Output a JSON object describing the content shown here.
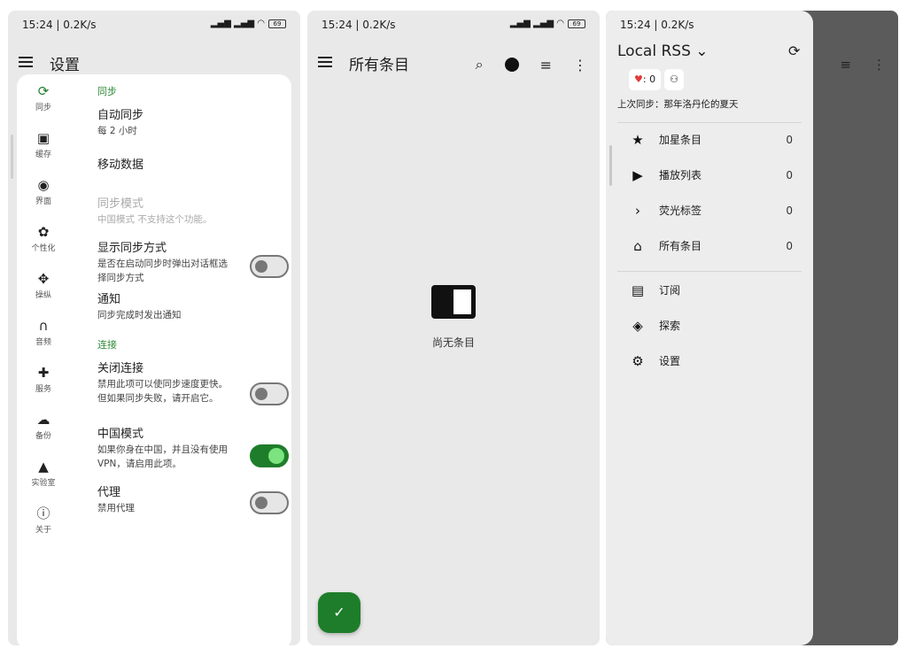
{
  "status": {
    "time": "15:24 | 0.2K/s",
    "signal": "ₗᵢₗ ₗᵢₗ",
    "battery": "69"
  },
  "settings_screen": {
    "title": "设置",
    "nav": [
      {
        "label": "同步",
        "icon": "sync-icon",
        "glyph": "⟳"
      },
      {
        "label": "缓存",
        "icon": "archive-icon",
        "glyph": "▣"
      },
      {
        "label": "界面",
        "icon": "eye-icon",
        "glyph": "◉"
      },
      {
        "label": "个性化",
        "icon": "palette-icon",
        "glyph": "✿"
      },
      {
        "label": "操纵",
        "icon": "gamepad-icon",
        "glyph": "✥"
      },
      {
        "label": "音频",
        "icon": "headphones-icon",
        "glyph": "∩"
      },
      {
        "label": "服务",
        "icon": "puzzle-icon",
        "glyph": "✚"
      },
      {
        "label": "备份",
        "icon": "cloud-upload-icon",
        "glyph": "☁"
      },
      {
        "label": "实验室",
        "icon": "school-icon",
        "glyph": "▲"
      },
      {
        "label": "关于",
        "icon": "info-icon",
        "glyph": "ⓘ"
      }
    ],
    "sections": {
      "sync": "同步",
      "connection": "连接"
    },
    "items": {
      "auto_sync": {
        "title": "自动同步",
        "desc": "每 2 小时"
      },
      "mobile_data": {
        "title": "移动数据"
      },
      "sync_mode": {
        "title": "同步模式",
        "desc": "中国模式 不支持这个功能。"
      },
      "show_sync_method": {
        "title": "显示同步方式",
        "desc": "是否在启动同步时弹出对话框选择同步方式",
        "on": false
      },
      "notify": {
        "title": "通知",
        "desc": "同步完成时发出通知"
      },
      "close_conn": {
        "title": "关闭连接",
        "desc": "禁用此项可以使同步速度更快。但如果同步失败，请开启它。",
        "on": false
      },
      "china_mode": {
        "title": "中国模式",
        "desc": "如果你身在中国，并且没有使用 VPN，请启用此项。",
        "on": true
      },
      "proxy": {
        "title": "代理",
        "desc": "禁用代理",
        "on": false
      }
    }
  },
  "items_screen": {
    "title": "所有条目",
    "empty": "尚无条目",
    "icons": [
      "search-icon",
      "filter-dot-icon",
      "playlist-icon",
      "more-vert-icon"
    ]
  },
  "drawer_screen": {
    "account": "Local RSS",
    "hearts": "0",
    "last_sync": "上次同步：那年洛丹伦的夏天",
    "items": [
      {
        "label": "加星条目",
        "count": "0",
        "icon": "star-icon",
        "glyph": "★"
      },
      {
        "label": "播放列表",
        "count": "0",
        "icon": "play-icon",
        "glyph": "▶"
      },
      {
        "label": "荧光标签",
        "count": "0",
        "icon": "chevron-right-icon",
        "glyph": "›"
      },
      {
        "label": "所有条目",
        "count": "0",
        "icon": "home-icon",
        "glyph": "⌂"
      }
    ],
    "links": [
      {
        "label": "订阅",
        "icon": "rss-icon",
        "glyph": "▤"
      },
      {
        "label": "探索",
        "icon": "compass-icon",
        "glyph": "◈"
      },
      {
        "label": "设置",
        "icon": "gear-icon",
        "glyph": "⚙"
      }
    ]
  },
  "colors": {
    "accent": "#1e7d2a",
    "switch_on_thumb": "#7be37f"
  }
}
